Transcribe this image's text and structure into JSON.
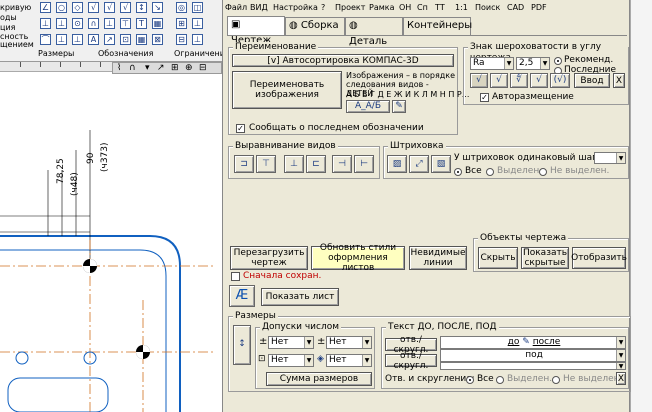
{
  "background": {
    "left_labels": [
      "кривую",
      "оды",
      "ция",
      "сность",
      "щением"
    ],
    "groups": [
      "Размеры",
      "Обозначения",
      "Ограничения"
    ],
    "dims": [
      "78,25",
      "(ч48)",
      "90",
      "(ч373)"
    ]
  },
  "menu": [
    "Файл",
    "ВИД",
    "Настройка",
    "?",
    "Проект",
    "Рамка",
    "ОН",
    "Сп",
    "ТТ",
    "1:1",
    "Поиск",
    "CAD",
    "PDF"
  ],
  "tabs": [
    {
      "label": "Чертеж",
      "active": true
    },
    {
      "label": "Сборка",
      "active": false
    },
    {
      "label": "Деталь",
      "active": false
    },
    {
      "label": "Контейнеры",
      "active": false
    }
  ],
  "rename": {
    "title": "Переименование",
    "autosort": "[v] Автосортировка КОМПАС-3D",
    "rename_btn": "Переименовать изображения",
    "hint": "Изображения – в порядке следования видов - ДЕТЕЙ",
    "alphabet": "А Б В Г Д Е Ж И К Л М Н П Р...",
    "report_label": "Сообщать о последнем обозначении"
  },
  "rough": {
    "title": "Знак шероховатости в углу чертежа",
    "param": "Ra",
    "value": "2,5",
    "opt1": "Рекоменд.",
    "opt2": "Последние",
    "input_btn": "Ввод",
    "close": "X",
    "auto": "Авторазмещение"
  },
  "align": {
    "title": "Выравнивание видов"
  },
  "hatch": {
    "title": "Штриховка",
    "same_step": "У штриховок одинаковый шаг, мм:",
    "all": "Все",
    "selected": "Выделен.",
    "not_selected": "Не выделен."
  },
  "actions": {
    "reload": "Перезагрузить чертеж",
    "update_styles": "Обновить стили оформления листов",
    "invisible": "Невидимые линии",
    "save_first": "Сначала сохран."
  },
  "objects": {
    "title": "Объекты чертежа",
    "hide": "Скрыть",
    "show_hidden": "Показать скрытые",
    "display": "Отобразить"
  },
  "show_sheet": "Показать лист",
  "dims": {
    "title": "Размеры",
    "tol_title": "Допуски числом",
    "none": "Нет",
    "sum": "Сумма размеров",
    "text_title": "Текст ДО, ПОСЛЕ, ПОД",
    "btn_round": "отв./скругл.",
    "before": "до",
    "after": "после",
    "under": "под",
    "holes": "Отв. и скругления:",
    "all": "Все",
    "selected": "Выделен.",
    "not_selected": "Не выделен."
  }
}
